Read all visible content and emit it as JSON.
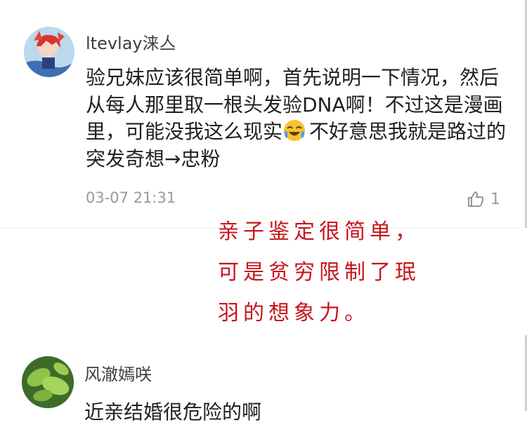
{
  "comments": [
    {
      "username": "ltevlay涞亼",
      "text": "验兄妹应该很简单啊，首先说明一下情况，然后从每人那里取一根头发验DNA啊！不过这是漫画里，可能没我这么现实",
      "text_after_emoji": "不好意思我就是路过的突发奇想→忠粉",
      "emoji": "tears-of-joy-emoji",
      "timestamp": "03-07 21:31",
      "likes": "1",
      "like_icon": "thumbs-up-icon",
      "avatar": "anime-character-avatar"
    },
    {
      "username": "风澈嫣咲",
      "text": "近亲结婚很危险的啊",
      "avatar": "green-leaves-avatar"
    }
  ],
  "annotation": {
    "lines": [
      "亲子鉴定很简单，",
      "可是贫穷限制了珉",
      "羽的想象力。"
    ],
    "color": "#c8141c"
  }
}
